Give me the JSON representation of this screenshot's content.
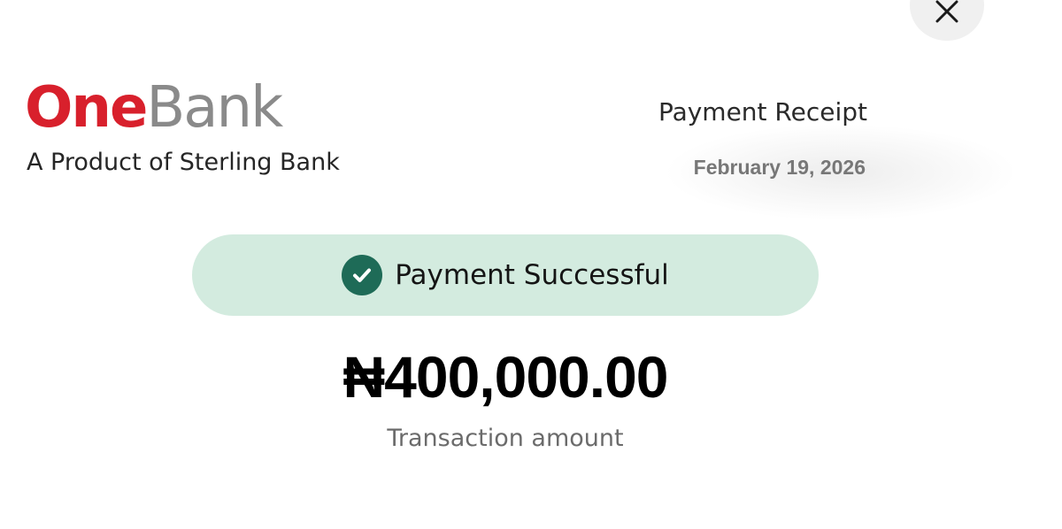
{
  "header": {
    "close_icon": "close-icon"
  },
  "brand": {
    "logo_part1": "One",
    "logo_part2": "Bank",
    "logo_part1_color": "#d8202c",
    "logo_part2_color": "#8a8a8a",
    "tagline": "A Product of Sterling Bank"
  },
  "receipt": {
    "title": "Payment Receipt",
    "date": "February 19, 2026"
  },
  "status": {
    "icon": "check-circle-icon",
    "text": "Payment Successful",
    "background_color": "#d3ebdf",
    "icon_color": "#1e6b57"
  },
  "transaction": {
    "amount": "₦400,000.00",
    "label": "Transaction amount"
  }
}
